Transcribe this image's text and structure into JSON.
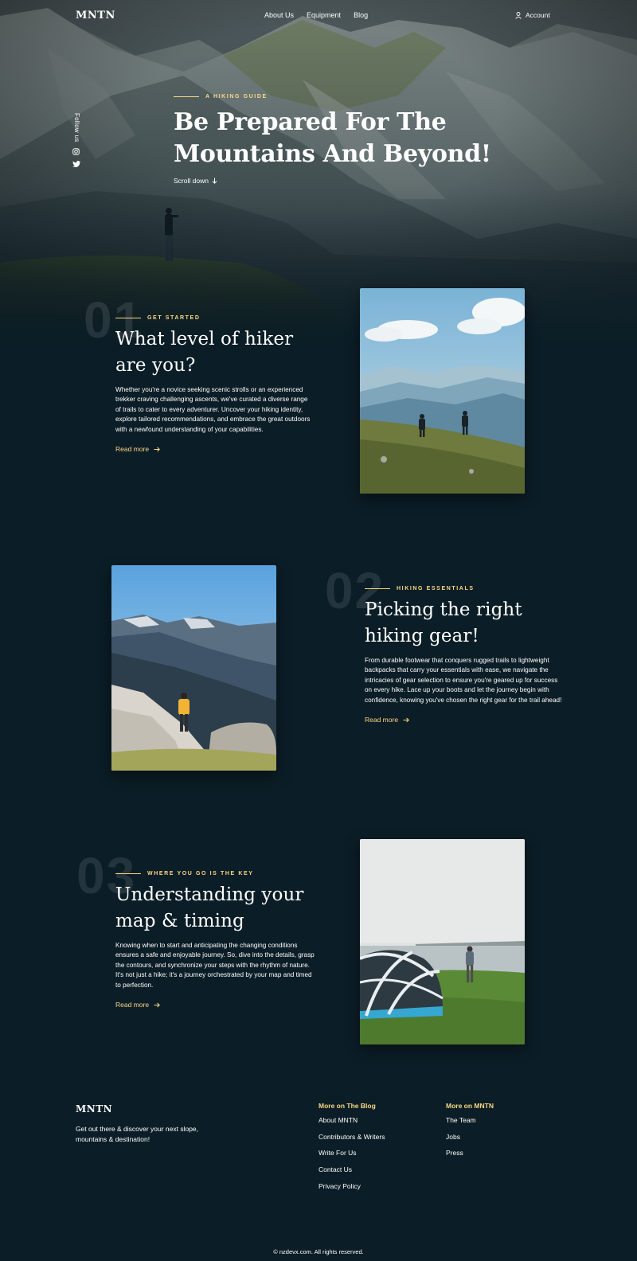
{
  "nav": {
    "logo": "MNTN",
    "links": [
      "About Us",
      "Equipment",
      "Blog"
    ],
    "account": "Account"
  },
  "hero": {
    "follow": "Follow us",
    "eyebrow": "A HIKING GUIDE",
    "title_line1": "Be Prepared For The",
    "title_line2": "Mountains And Beyond!",
    "scroll": "Scroll down"
  },
  "sections": [
    {
      "number": "01",
      "eyebrow": "GET STARTED",
      "title_line1": "What level of hiker",
      "title_line2": "are you?",
      "body": "Whether you're a novice seeking scenic strolls or an experienced trekker craving challenging ascents, we've curated a diverse range of trails to cater to every adventurer. Uncover your hiking identity, explore tailored recommendations, and embrace the great outdoors with a newfound understanding of your capabilities.",
      "cta": "Read more"
    },
    {
      "number": "02",
      "eyebrow": "HIKING ESSENTIALS",
      "title_line1": "Picking the right",
      "title_line2": "hiking gear!",
      "body": "From durable footwear that conquers rugged trails to lightweight backpacks that carry your essentials with ease, we navigate the intricacies of gear selection to ensure you're geared up for success on every hike. Lace up your boots and let the journey begin with confidence, knowing you've chosen the right gear for the trail ahead!",
      "cta": "Read more"
    },
    {
      "number": "03",
      "eyebrow": "WHERE YOU GO IS THE KEY",
      "title_line1": "Understanding your",
      "title_line2": "map & timing",
      "body": "Knowing when to start and anticipating the changing conditions ensures a safe and enjoyable journey. So, dive into the details, grasp the contours, and synchronize your steps with the rhythm of nature. It's not just a hike; it's a journey orchestrated by your map and timed to perfection.",
      "cta": "Read more"
    }
  ],
  "footer": {
    "logo": "MNTN",
    "tagline": "Get out there & discover your next slope, mountains & destination!",
    "blog_heading": "More on The Blog",
    "blog_links": [
      "About MNTN",
      "Contributors & Writers",
      "Write For Us",
      "Contact Us",
      "Privacy Policy"
    ],
    "mntn_heading": "More on MNTN",
    "mntn_links": [
      "The Team",
      "Jobs",
      "Press"
    ],
    "copyright": "© nzdevx.com. All rights reserved."
  },
  "colors": {
    "background": "#0b1d26",
    "accent": "#fbd784",
    "text": "#ffffff"
  },
  "icons": [
    "user-icon",
    "instagram-icon",
    "twitter-icon",
    "arrow-down-icon",
    "arrow-right-icon"
  ]
}
